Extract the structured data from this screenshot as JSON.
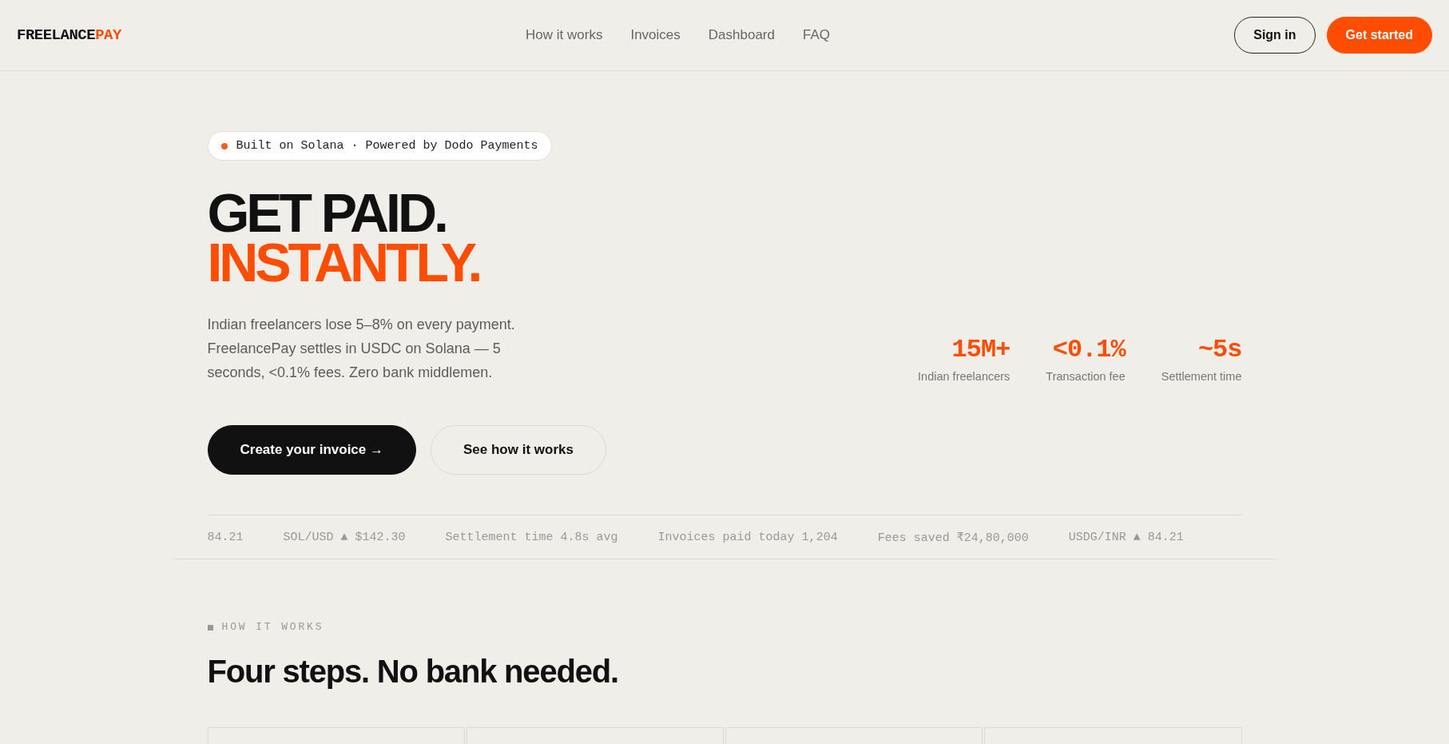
{
  "header": {
    "logo": {
      "primary": "FREELANCE",
      "accent": "PAY"
    },
    "nav": [
      {
        "label": "How it works"
      },
      {
        "label": "Invoices"
      },
      {
        "label": "Dashboard"
      },
      {
        "label": "FAQ"
      }
    ],
    "actions": [
      {
        "label": "Sign in",
        "kind": "outline"
      },
      {
        "label": "Get started",
        "kind": "primary"
      }
    ]
  },
  "hero": {
    "badge": "Built on Solana · Powered by Dodo Payments",
    "headline": {
      "line_1": "GET PAID.",
      "line_2": "INSTANTLY."
    },
    "description": "Indian freelancers lose 5–8% on every payment. FreelancePay settles in USDC on Solana — 5 seconds, <0.1% fees. Zero bank middlemen.",
    "stats": [
      {
        "value": "15M+",
        "label": "Indian freelancers"
      },
      {
        "value": "<0.1%",
        "label": "Transaction fee"
      },
      {
        "value": "~5s",
        "label": "Settlement time"
      }
    ],
    "buttons": [
      {
        "label": "Create your invoice →",
        "kind": "primary"
      },
      {
        "label": "See how it works",
        "kind": "secondary"
      }
    ]
  },
  "ticker": [
    "84.21",
    "SOL/USD ▲ $142.30",
    "Settlement time 4.8s avg",
    "Invoices paid today 1,204",
    "Fees saved ₹24,80,000",
    "USDG/INR ▲ 84.21"
  ],
  "how_it_works": {
    "eyebrow": "HOW IT WORKS",
    "title": "Four steps. No bank needed."
  }
}
